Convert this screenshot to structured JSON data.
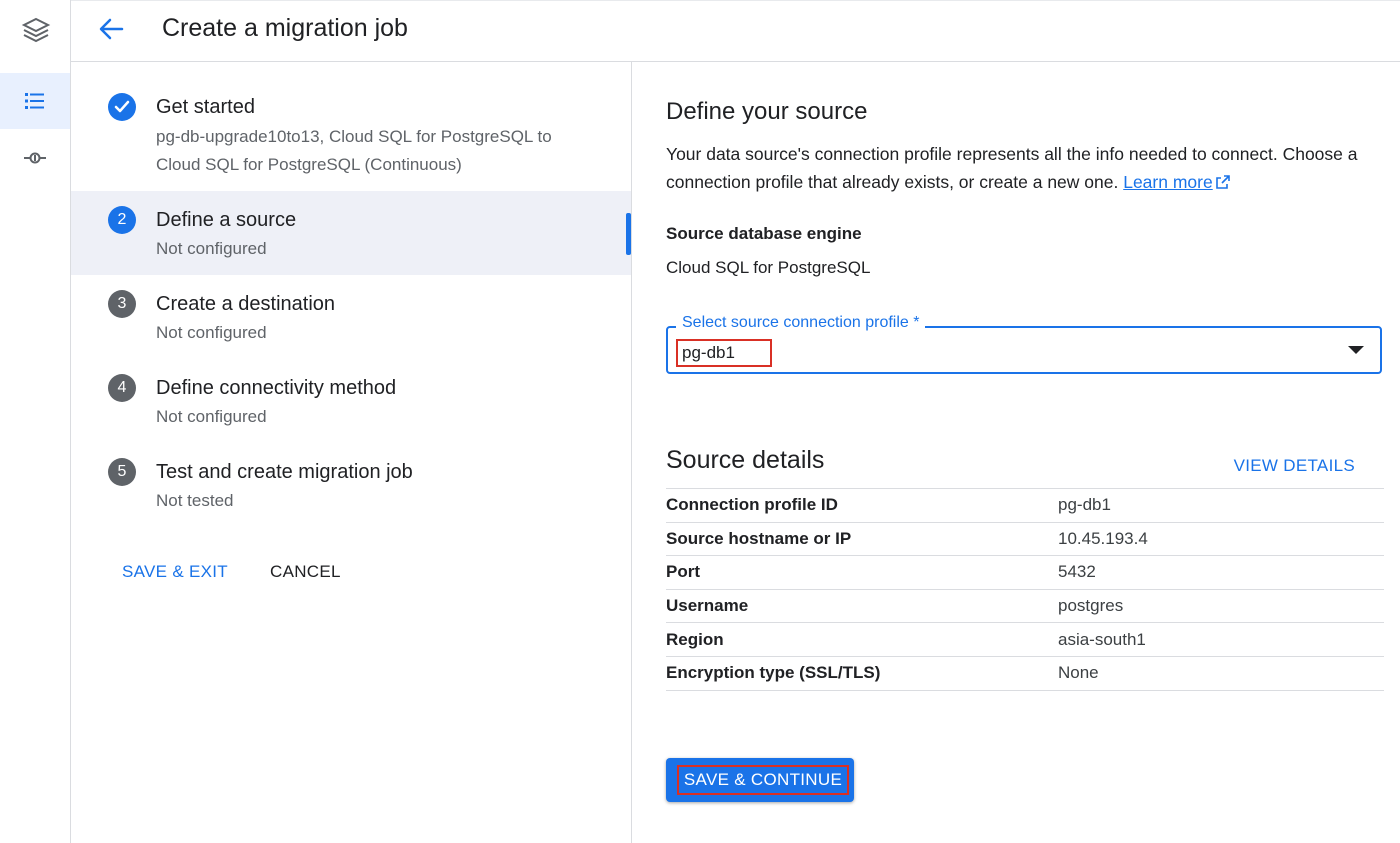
{
  "header": {
    "title": "Create a migration job"
  },
  "rail": {
    "items": [
      {
        "icon": "layers-logo-icon"
      },
      {
        "icon": "list-icon",
        "active": true
      },
      {
        "icon": "connection-icon"
      }
    ]
  },
  "steps": [
    {
      "number": "",
      "status": "done",
      "title": "Get started",
      "subtitle": "pg-db-upgrade10to13, Cloud SQL for PostgreSQL to Cloud SQL for PostgreSQL (Continuous)"
    },
    {
      "number": "2",
      "status": "current",
      "title": "Define a source",
      "subtitle": "Not configured"
    },
    {
      "number": "3",
      "status": "pending",
      "title": "Create a destination",
      "subtitle": "Not configured"
    },
    {
      "number": "4",
      "status": "pending",
      "title": "Define connectivity method",
      "subtitle": "Not configured"
    },
    {
      "number": "5",
      "status": "pending",
      "title": "Test and create migration job",
      "subtitle": "Not tested"
    }
  ],
  "stepper_actions": {
    "save_exit": "SAVE & EXIT",
    "cancel": "CANCEL"
  },
  "source": {
    "heading": "Define your source",
    "description": "Your data source's connection profile represents all the info needed to connect. Choose a connection profile that already exists, or create a new one.",
    "learn_more": "Learn more",
    "engine_label": "Source database engine",
    "engine_value": "Cloud SQL for PostgreSQL",
    "profile_label": "Select source connection profile *",
    "profile_value": "pg-db1"
  },
  "details": {
    "heading": "Source details",
    "view_details": "VIEW DETAILS",
    "rows": [
      {
        "key": "Connection profile ID",
        "value": "pg-db1"
      },
      {
        "key": "Source hostname or IP",
        "value": "10.45.193.4"
      },
      {
        "key": "Port",
        "value": "5432"
      },
      {
        "key": "Username",
        "value": "postgres"
      },
      {
        "key": "Region",
        "value": "asia-south1"
      },
      {
        "key": "Encryption type (SSL/TLS)",
        "value": "None"
      }
    ]
  },
  "primary_action": "SAVE & CONTINUE",
  "colors": {
    "accent": "#1a73e8",
    "highlight_border": "#d93025"
  }
}
